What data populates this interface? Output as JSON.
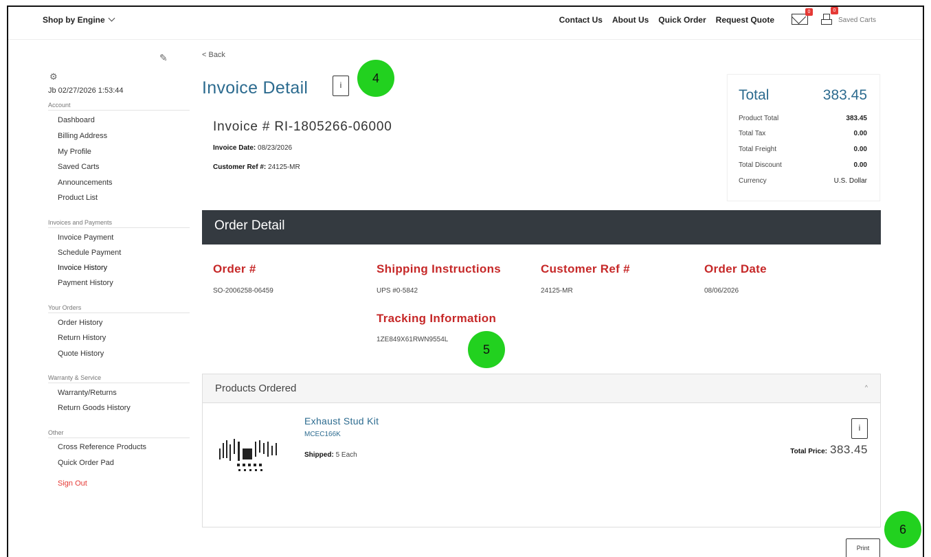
{
  "topbar": {
    "shop_by_engine": "Shop by Engine",
    "nav": [
      "Contact Us",
      "About Us",
      "Quick Order",
      "Request Quote"
    ],
    "mail_badge": "0",
    "cart_badge": "0",
    "saved_carts": "Saved Carts"
  },
  "sidebar": {
    "last_login": "Jb 02/27/2026 1:53:44",
    "sections": [
      {
        "title": "Account",
        "items": [
          "Dashboard",
          "Billing Address",
          "My Profile",
          "Saved Carts",
          "Announcements",
          "Product List"
        ]
      },
      {
        "title": "Invoices and Payments",
        "items": [
          "Invoice Payment",
          "Schedule Payment",
          "Invoice History",
          "Payment History"
        ]
      },
      {
        "title": "Your Orders",
        "items": [
          "Order History",
          "Return History",
          "Quote History"
        ]
      },
      {
        "title": "Warranty & Service",
        "items": [
          "Warranty/Returns",
          "Return Goods History"
        ]
      },
      {
        "title": "Other",
        "items": [
          "Cross Reference Products",
          "Quick Order Pad"
        ]
      }
    ],
    "sign_out": "Sign Out"
  },
  "main": {
    "back": "< Back",
    "title": "Invoice Detail",
    "info_button": "i",
    "invoice_number": "Invoice # RI-1805266-06000",
    "invoice_date_label": "Invoice Date:",
    "invoice_date": "08/23/2026",
    "customer_ref_label": "Customer Ref #:",
    "customer_ref": "24125-MR"
  },
  "totals": {
    "label": "Total",
    "value": "383.45",
    "rows": [
      {
        "label": "Product Total",
        "value": "383.45"
      },
      {
        "label": "Total Tax",
        "value": "0.00"
      },
      {
        "label": "Total Freight",
        "value": "0.00"
      },
      {
        "label": "Total Discount",
        "value": "0.00"
      },
      {
        "label": "Currency",
        "value": "U.S. Dollar"
      }
    ]
  },
  "order_detail": {
    "header": "Order Detail",
    "order_num_label": "Order #",
    "order_num": "SO-2006258-06459",
    "shipping_label": "Shipping Instructions",
    "shipping": "UPS #0-5842",
    "customer_ref_label": "Customer Ref #",
    "customer_ref": "24125-MR",
    "order_date_label": "Order Date",
    "order_date": "08/06/2026",
    "tracking_label": "Tracking Information",
    "tracking": "1ZE849X61RWN9554L"
  },
  "products": {
    "header": "Products Ordered",
    "collapse": "^",
    "items": [
      {
        "name": "Exhaust Stud Kit",
        "sku": "MCEC166K",
        "shipped_label": "Shipped:",
        "shipped": "5 Each",
        "total_label": "Total Price:",
        "total": "383.45",
        "button": "i"
      }
    ]
  },
  "print_button": "Print",
  "callouts": [
    "4",
    "5",
    "6"
  ]
}
